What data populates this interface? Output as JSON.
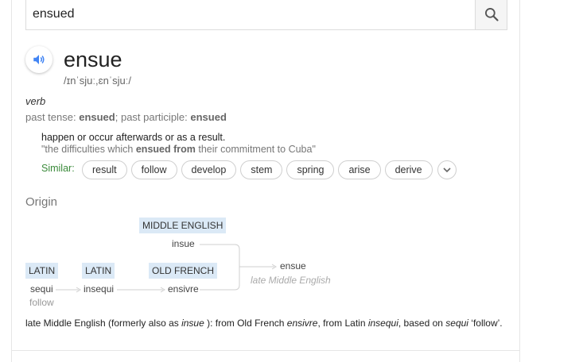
{
  "search": {
    "value": "ensued"
  },
  "entry": {
    "word": "ensue",
    "phonetic": "/ɪnˈsjuː,ɛnˈsjuː/",
    "part_of_speech": "verb",
    "forms": {
      "past_tense_label": "past tense: ",
      "past_tense": "ensued",
      "sep": "; past participle: ",
      "past_participle": "ensued"
    },
    "definition": "happen or occur afterwards or as a result.",
    "example": {
      "pre": "\"the difficulties which ",
      "bold": "ensued from",
      "post": " their commitment to Cuba\""
    },
    "similar_label": "Similar:",
    "similar": [
      "result",
      "follow",
      "develop",
      "stem",
      "spring",
      "arise",
      "derive"
    ]
  },
  "origin": {
    "title": "Origin",
    "nodes": {
      "middle_english_label": "MIDDLE ENGLISH",
      "middle_english_word": "insue",
      "latin1_label": "LATIN",
      "latin1_word": "sequi",
      "latin1_gloss": "follow",
      "latin2_label": "LATIN",
      "latin2_word": "insequi",
      "old_french_label": "OLD FRENCH",
      "old_french_word": "ensivre",
      "result_word": "ensue",
      "result_period": "late Middle English"
    },
    "text": {
      "p1": "late Middle English (formerly also as ",
      "w1": "insue",
      "p2": " ): from Old French ",
      "w2": "ensivre",
      "p3": ", from Latin ",
      "w3": "insequi",
      "p4": ", based on ",
      "w4": "sequi",
      "p5": " ‘follow’."
    }
  },
  "colors": {
    "similar_green": "#3a8a3a",
    "speaker_blue": "#4285f4",
    "etym_box_bg": "#dbe9f6"
  },
  "icons": {
    "search": "search-icon",
    "speaker": "speaker-icon",
    "expand": "chevron-down-icon"
  }
}
